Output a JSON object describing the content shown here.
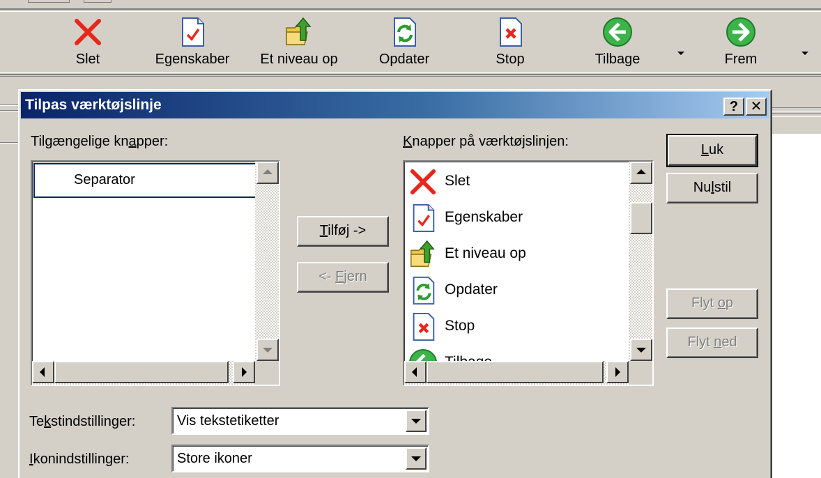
{
  "toolbar": {
    "buttons": [
      {
        "label": "Slet",
        "icon": "delete-x-icon"
      },
      {
        "label": "Egenskaber",
        "icon": "properties-icon"
      },
      {
        "label": "Et niveau op",
        "icon": "folder-up-icon"
      },
      {
        "label": "Opdater",
        "icon": "refresh-icon"
      },
      {
        "label": "Stop",
        "icon": "stop-icon"
      },
      {
        "label": "Tilbage",
        "icon": "back-arrow-icon"
      },
      {
        "label": "Frem",
        "icon": "forward-arrow-icon"
      }
    ]
  },
  "dialog": {
    "title": "Tilpas værktøjslinje",
    "help_label": "?",
    "close_label": "✕",
    "available": {
      "label_pre": "Tilgængelige kn",
      "label_accel": "a",
      "label_post": "pper:",
      "items": [
        {
          "label": "Separator"
        }
      ]
    },
    "current": {
      "label_pre": "",
      "label_accel": "K",
      "label_post": "napper på værktøjslinjen:",
      "items": [
        {
          "label": "Slet",
          "icon": "delete-x-icon"
        },
        {
          "label": "Egenskaber",
          "icon": "properties-icon"
        },
        {
          "label": "Et niveau op",
          "icon": "folder-up-icon"
        },
        {
          "label": "Opdater",
          "icon": "refresh-icon"
        },
        {
          "label": "Stop",
          "icon": "stop-icon"
        },
        {
          "label": "Tilbage",
          "icon": "back-arrow-icon"
        }
      ]
    },
    "buttons": {
      "add_pre": "",
      "add_accel": "T",
      "add_post": "ilføj ->",
      "remove_pre": "<- ",
      "remove_accel": "F",
      "remove_post": "jern",
      "close_pre": "",
      "close_accel": "L",
      "close_post": "uk",
      "reset_pre": "Nu",
      "reset_accel": "l",
      "reset_post": "stil",
      "move_up_pre": "Flyt ",
      "move_up_accel": "o",
      "move_up_post": "p",
      "move_down_pre": "Flyt ",
      "move_down_accel": "n",
      "move_down_post": "ed"
    },
    "text_options": {
      "label_pre": "Te",
      "label_accel": "k",
      "label_post": "stindstillinger:",
      "value": "Vis tekstetiketter"
    },
    "icon_options": {
      "label_pre": "",
      "label_accel": "I",
      "label_post": "konindstillinger:",
      "value": "Store ikoner"
    }
  }
}
